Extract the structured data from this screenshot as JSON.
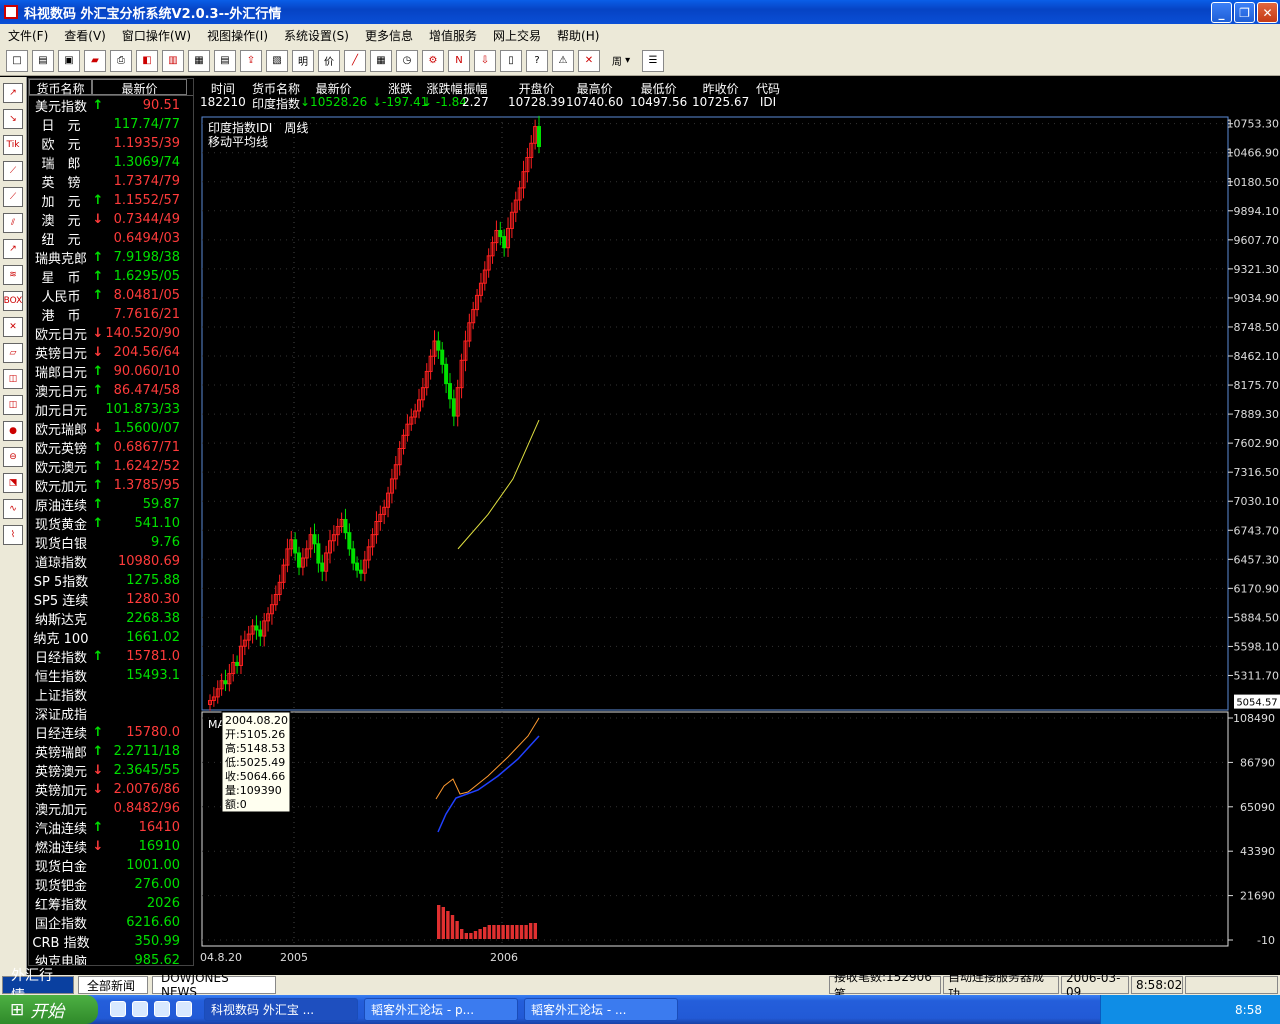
{
  "window": {
    "title": "科视数码 外汇宝分析系统V2.0.3--外汇行情"
  },
  "menu": [
    "文件(F)",
    "查看(V)",
    "窗口操作(W)",
    "视图操作(I)",
    "系统设置(S)",
    "更多信息",
    "增值服务",
    "网上交易",
    "帮助(H)"
  ],
  "toolbar": {
    "period_value": "周"
  },
  "quote_table": {
    "headers": [
      "货币名称",
      "最新价"
    ],
    "rows": [
      {
        "name": "美元指数",
        "arrow": "↑",
        "value": "90.51",
        "dir": "up"
      },
      {
        "name": "日　元",
        "arrow": "",
        "value": "117.74/77",
        "dir": "dn"
      },
      {
        "name": "欧　元",
        "arrow": "",
        "value": "1.1935/39",
        "dir": "up"
      },
      {
        "name": "瑞　郎",
        "arrow": "",
        "value": "1.3069/74",
        "dir": "dn"
      },
      {
        "name": "英　镑",
        "arrow": "",
        "value": "1.7374/79",
        "dir": "up"
      },
      {
        "name": "加　元",
        "arrow": "↑",
        "value": "1.1552/57",
        "dir": "up"
      },
      {
        "name": "澳　元",
        "arrow": "↓",
        "value": "0.7344/49",
        "dir": "up"
      },
      {
        "name": "纽　元",
        "arrow": "",
        "value": "0.6494/03",
        "dir": "up"
      },
      {
        "name": "瑞典克郎",
        "arrow": "↑",
        "value": "7.9198/38",
        "dir": "dn"
      },
      {
        "name": "星　币",
        "arrow": "↑",
        "value": "1.6295/05",
        "dir": "dn"
      },
      {
        "name": "人民币",
        "arrow": "↑",
        "value": "8.0481/05",
        "dir": "up"
      },
      {
        "name": "港　币",
        "arrow": "",
        "value": "7.7616/21",
        "dir": "up"
      },
      {
        "name": "欧元日元",
        "arrow": "↓",
        "value": "140.520/90",
        "dir": "up"
      },
      {
        "name": "英镑日元",
        "arrow": "↓",
        "value": "204.56/64",
        "dir": "up"
      },
      {
        "name": "瑞郎日元",
        "arrow": "↑",
        "value": "90.060/10",
        "dir": "up"
      },
      {
        "name": "澳元日元",
        "arrow": "↑",
        "value": "86.474/58",
        "dir": "up"
      },
      {
        "name": "加元日元",
        "arrow": "",
        "value": "101.873/33",
        "dir": "dn"
      },
      {
        "name": "欧元瑞郎",
        "arrow": "↓",
        "value": "1.5600/07",
        "dir": "dn"
      },
      {
        "name": "欧元英镑",
        "arrow": "↑",
        "value": "0.6867/71",
        "dir": "up"
      },
      {
        "name": "欧元澳元",
        "arrow": "↑",
        "value": "1.6242/52",
        "dir": "up"
      },
      {
        "name": "欧元加元",
        "arrow": "↑",
        "value": "1.3785/95",
        "dir": "up"
      },
      {
        "name": "原油连续",
        "arrow": "↑",
        "value": "59.87",
        "dir": "dn"
      },
      {
        "name": "现货黄金",
        "arrow": "↑",
        "value": "541.10",
        "dir": "dn"
      },
      {
        "name": "现货白银",
        "arrow": "",
        "value": "9.76",
        "dir": "dn"
      },
      {
        "name": "道琼指数",
        "arrow": "",
        "value": "10980.69",
        "dir": "up"
      },
      {
        "name": "SP 5指数",
        "arrow": "",
        "value": "1275.88",
        "dir": "dn"
      },
      {
        "name": "SP5 连续",
        "arrow": "",
        "value": "1280.30",
        "dir": "up"
      },
      {
        "name": "纳斯达克",
        "arrow": "",
        "value": "2268.38",
        "dir": "dn"
      },
      {
        "name": "纳克 100",
        "arrow": "",
        "value": "1661.02",
        "dir": "dn"
      },
      {
        "name": "日经指数",
        "arrow": "↑",
        "value": "15781.0",
        "dir": "up"
      },
      {
        "name": "恒生指数",
        "arrow": "",
        "value": "15493.1",
        "dir": "dn"
      },
      {
        "name": "上证指数",
        "arrow": "",
        "value": "",
        "dir": "nu"
      },
      {
        "name": "深证成指",
        "arrow": "",
        "value": "",
        "dir": "nu"
      },
      {
        "name": "日经连续",
        "arrow": "↑",
        "value": "15780.0",
        "dir": "up"
      },
      {
        "name": "英镑瑞郎",
        "arrow": "↑",
        "value": "2.2711/18",
        "dir": "dn"
      },
      {
        "name": "英镑澳元",
        "arrow": "↓",
        "value": "2.3645/55",
        "dir": "dn"
      },
      {
        "name": "英镑加元",
        "arrow": "↓",
        "value": "2.0076/86",
        "dir": "up"
      },
      {
        "name": "澳元加元",
        "arrow": "",
        "value": "0.8482/96",
        "dir": "up"
      },
      {
        "name": "汽油连续",
        "arrow": "↑",
        "value": "16410",
        "dir": "up"
      },
      {
        "name": "燃油连续",
        "arrow": "↓",
        "value": "16910",
        "dir": "dn"
      },
      {
        "name": "现货白金",
        "arrow": "",
        "value": "1001.00",
        "dir": "dn"
      },
      {
        "name": "现货钯金",
        "arrow": "",
        "value": "276.00",
        "dir": "dn"
      },
      {
        "name": "红筹指数",
        "arrow": "",
        "value": "2026",
        "dir": "dn"
      },
      {
        "name": "国企指数",
        "arrow": "",
        "value": "6216.60",
        "dir": "dn"
      },
      {
        "name": "CRB 指数",
        "arrow": "",
        "value": "350.99",
        "dir": "dn"
      },
      {
        "name": "纳克电脑",
        "arrow": "",
        "value": "985.62",
        "dir": "dn"
      }
    ]
  },
  "info_bar": [
    {
      "label": "时间",
      "value": "182210",
      "color": "#ffffff"
    },
    {
      "label": "货币名称",
      "value": "印度指数",
      "color": "#ffffff"
    },
    {
      "label": "最新价",
      "value": "↓10528.26",
      "color": "#00e000"
    },
    {
      "label": "涨跌",
      "value": "↓-197.41",
      "color": "#00e000"
    },
    {
      "label": "涨跌幅",
      "value": "↓ -1.84",
      "color": "#00e000"
    },
    {
      "label": "振幅",
      "value": "2.27",
      "color": "#ffffff"
    },
    {
      "label": "开盘价",
      "value": "10728.39",
      "color": "#ffffff"
    },
    {
      "label": "最高价",
      "value": "10740.60",
      "color": "#ffffff"
    },
    {
      "label": "最低价",
      "value": "10497.56",
      "color": "#ffffff"
    },
    {
      "label": "昨收价",
      "value": "10725.67",
      "color": "#ffffff"
    },
    {
      "label": "代码",
      "value": "IDI",
      "color": "#ffffff"
    }
  ],
  "chart": {
    "title_line1": "印度指数IDI　周线",
    "title_line2": "移动平均线",
    "sub_label": "MA",
    "last_price_label": "5054.57"
  },
  "tooltip": {
    "lines": [
      "2004.08.20",
      "开:5105.26",
      "高:5148.53",
      "低:5025.49",
      "收:5064.66",
      "量:109390",
      "额:0"
    ]
  },
  "chart_data": {
    "type": "candlestick",
    "title": "印度指数IDI 周线",
    "price_axis": {
      "ticks": [
        "10753.30",
        "10466.90",
        "10180.50",
        "9894.10",
        "9607.70",
        "9321.30",
        "9034.90",
        "8748.50",
        "8462.10",
        "8175.70",
        "7889.30",
        "7602.90",
        "7316.50",
        "7030.10",
        "6743.70",
        "6457.30",
        "6170.90",
        "5884.50",
        "5598.10",
        "5311.70"
      ],
      "range": [
        5050,
        10760
      ]
    },
    "sub_axis": {
      "ticks": [
        "108490",
        "86790",
        "65090",
        "43390",
        "21690",
        "-10"
      ]
    },
    "x_axis": {
      "tick_labels": [
        "04.8.20",
        "2005",
        "2006"
      ]
    },
    "close_series": [
      5065,
      5100,
      5180,
      5260,
      5230,
      5330,
      5440,
      5410,
      5600,
      5660,
      5720,
      5800,
      5760,
      5700,
      5850,
      5920,
      6010,
      6110,
      6230,
      6400,
      6560,
      6650,
      6520,
      6380,
      6470,
      6560,
      6700,
      6610,
      6420,
      6340,
      6520,
      6640,
      6700,
      6780,
      6850,
      6720,
      6560,
      6420,
      6350,
      6320,
      6450,
      6580,
      6700,
      6830,
      6900,
      6970,
      7110,
      7250,
      7390,
      7550,
      7680,
      7790,
      7860,
      7920,
      8030,
      8150,
      8310,
      8460,
      8610,
      8520,
      8380,
      8190,
      8040,
      7870,
      8150,
      8420,
      8610,
      8790,
      8920,
      9060,
      9180,
      9310,
      9450,
      9580,
      9700,
      9640,
      9530,
      9720,
      9880,
      10000,
      10120,
      10280,
      10420,
      10560,
      10725,
      10528
    ],
    "ma_overlay": {
      "start_value": 6560,
      "end_value": 7830
    }
  }
}
